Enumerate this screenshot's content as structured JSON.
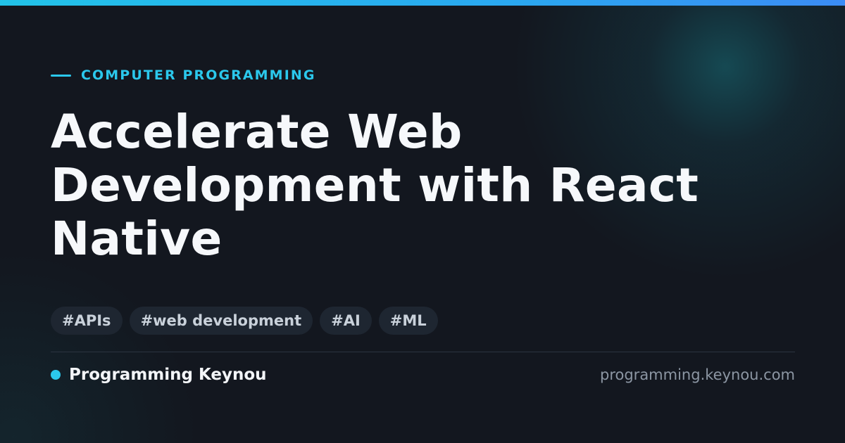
{
  "eyebrow": {
    "text": "COMPUTER PROGRAMMING"
  },
  "title": {
    "text": "Accelerate Web Development with React Native"
  },
  "tags": [
    "#APIs",
    "#web development",
    "#AI",
    "#ML"
  ],
  "footer": {
    "brand_name": "Programming Keynou",
    "domain": "programming.keynou.com"
  },
  "colors": {
    "background": "#13171f",
    "accent": "#2bc8ec",
    "title_text": "#f6f8fb",
    "tag_background": "#1e2631",
    "tag_text": "#c9d1da",
    "muted_text": "#8c96a3"
  }
}
